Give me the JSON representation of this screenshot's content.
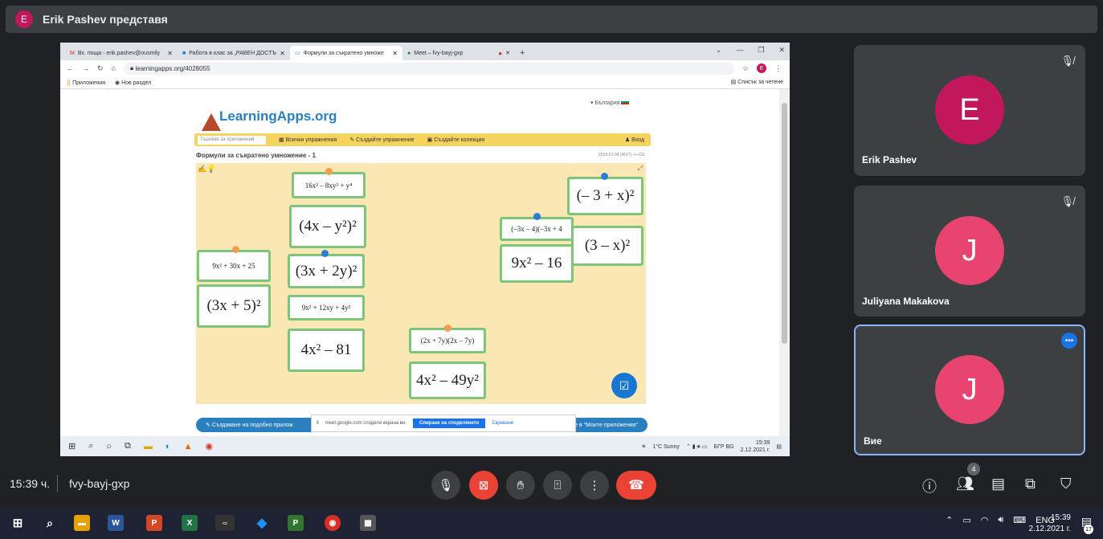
{
  "presenter": {
    "initial": "E",
    "text": "Erik Pashev представя"
  },
  "browser": {
    "tabs": [
      {
        "label": "Вх. поща - erik.pashev@ousmily",
        "icon": "M"
      },
      {
        "label": "Работа в клас за „РАВЕН ДОСТЪ",
        "icon": "■"
      },
      {
        "label": "Формули за съкратено умноже",
        "icon": "▭"
      },
      {
        "label": "Meet – fvy-bayj-gxp",
        "icon": "●"
      }
    ],
    "url": "learningapps.org/4028055",
    "bookmarks": [
      "Приложения",
      "Нов раздел"
    ],
    "reading_list": "Списък за четене"
  },
  "learningapps": {
    "logo": "LearningApps.org",
    "language": "▾ България",
    "search_placeholder": "Търсене за приложения",
    "nav": [
      "Всички упражнения",
      "Създайте упражнение",
      "Създайте колекция"
    ],
    "login": "Вход",
    "exercise_title": "Формули за съкратено умножение - 1",
    "exercise_date": "2018-01-08 (Ж)(Т) ++-ΩΩ",
    "cards": [
      {
        "text": "16x² – 8xy² + y⁴",
        "size": "small"
      },
      {
        "text": "(4x – y²)²",
        "size": "big"
      },
      {
        "text": "9x² + 30x + 25",
        "size": "small"
      },
      {
        "text": "(3x + 5)²",
        "size": "big"
      },
      {
        "text": "(3x + 2y)²",
        "size": "big"
      },
      {
        "text": "9x² + 12xy + 4y²",
        "size": "small"
      },
      {
        "text": "4x² – 81",
        "size": "big"
      },
      {
        "text": "(2x + 7y)(2x – 7y)",
        "size": "small"
      },
      {
        "text": "4x² – 49y²",
        "size": "big"
      },
      {
        "text": "(–3x – 4)(–3x + 4",
        "size": "small"
      },
      {
        "text": "9x² – 16",
        "size": "big"
      },
      {
        "text": "(– 3 + x)²",
        "size": "big"
      },
      {
        "text": "(3 – x)²",
        "size": "big"
      }
    ],
    "bottom_left": "Създаване на подобно прилож",
    "bottom_right": "оставяне в \"Моите приложения\""
  },
  "share_notice": {
    "text": "meet.google.com споделя екрана ви.",
    "stop": "Спиране на споделянето",
    "hide": "Скриване"
  },
  "inner_tray": {
    "weather": "1°C Sunny",
    "lang": "БГР BG",
    "time": "15:39",
    "date": "2.12.2021 г."
  },
  "participants": [
    {
      "initial": "E",
      "name": "Erik Pashev",
      "color": "#c2185b"
    },
    {
      "initial": "J",
      "name": "Juliyana Makakova",
      "color": "#e8446f"
    },
    {
      "initial": "J",
      "name": "Вие",
      "color": "#e8446f"
    }
  ],
  "meeting": {
    "time": "15:39 ч.",
    "code": "fvy-bayj-gxp",
    "people_count": "4"
  },
  "taskbar": {
    "lang": "ENG",
    "time": "15:39",
    "date": "2.12.2021 г.",
    "notifications": "17"
  }
}
